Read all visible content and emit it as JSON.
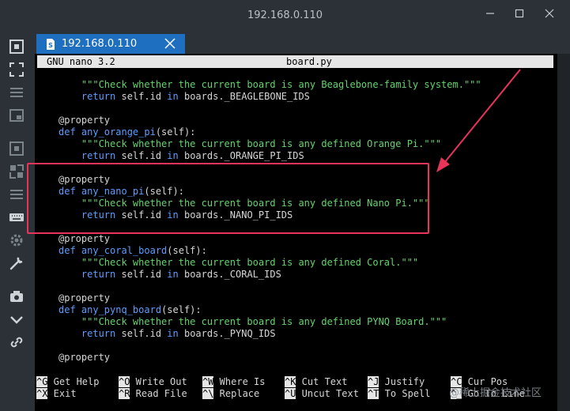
{
  "window": {
    "title": "192.168.0.110"
  },
  "tab": {
    "label": "192.168.0.110"
  },
  "nano": {
    "version": "GNU nano 3.2",
    "filename": "board.py"
  },
  "code_lines": [
    [
      [
        "    ",
        "w"
      ],
      [
        "\"\"\"Check whether the current board is any Beaglebone-family system.\"\"\"",
        "g"
      ]
    ],
    [
      [
        "    return ",
        "k"
      ],
      [
        "self.id ",
        "w"
      ],
      [
        "in ",
        "k"
      ],
      [
        "boards._BEAGLEBONE_IDS",
        "w"
      ]
    ],
    [],
    [
      [
        "@property",
        "w"
      ]
    ],
    [
      [
        "def ",
        "k"
      ],
      [
        "any_orange_pi",
        "k"
      ],
      [
        "(self):",
        "w"
      ]
    ],
    [
      [
        "    ",
        "w"
      ],
      [
        "\"\"\"Check whether the current board is any defined Orange Pi.\"\"\"",
        "g"
      ]
    ],
    [
      [
        "    return ",
        "k"
      ],
      [
        "self.id ",
        "w"
      ],
      [
        "in ",
        "k"
      ],
      [
        "boards._ORANGE_PI_IDS",
        "w"
      ]
    ],
    [],
    [
      [
        "@property",
        "w"
      ]
    ],
    [
      [
        "def ",
        "k"
      ],
      [
        "any_nano_pi",
        "k"
      ],
      [
        "(self):",
        "w"
      ]
    ],
    [
      [
        "    ",
        "w"
      ],
      [
        "\"\"\"Check whether the current board is any defined Nano Pi.\"\"\"",
        "g"
      ]
    ],
    [
      [
        "    return ",
        "k"
      ],
      [
        "self.id ",
        "w"
      ],
      [
        "in ",
        "k"
      ],
      [
        "boards._NANO_PI_IDS",
        "w"
      ]
    ],
    [],
    [
      [
        "@property",
        "w"
      ]
    ],
    [
      [
        "def ",
        "k"
      ],
      [
        "any_coral_board",
        "k"
      ],
      [
        "(self):",
        "w"
      ]
    ],
    [
      [
        "    ",
        "w"
      ],
      [
        "\"\"\"Check whether the current board is any defined Coral.\"\"\"",
        "g"
      ]
    ],
    [
      [
        "    return ",
        "k"
      ],
      [
        "self.id ",
        "w"
      ],
      [
        "in ",
        "k"
      ],
      [
        "boards._CORAL_IDS",
        "w"
      ]
    ],
    [],
    [
      [
        "@property",
        "w"
      ]
    ],
    [
      [
        "def ",
        "k"
      ],
      [
        "any_pynq_board",
        "k"
      ],
      [
        "(self):",
        "w"
      ]
    ],
    [
      [
        "    ",
        "w"
      ],
      [
        "\"\"\"Check whether the current board is any defined PYNQ Board.\"\"\"",
        "g"
      ]
    ],
    [
      [
        "    return ",
        "k"
      ],
      [
        "self.id ",
        "w"
      ],
      [
        "in ",
        "k"
      ],
      [
        "boards._PYNQ_IDS",
        "w"
      ]
    ],
    [],
    [
      [
        "@property",
        "w"
      ]
    ]
  ],
  "shortcuts": [
    {
      "key": "^G",
      "label": "Get Help"
    },
    {
      "key": "^O",
      "label": "Write Out"
    },
    {
      "key": "^W",
      "label": "Where Is"
    },
    {
      "key": "^K",
      "label": "Cut Text"
    },
    {
      "key": "^J",
      "label": "Justify"
    },
    {
      "key": "^C",
      "label": "Cur Pos"
    },
    {
      "key": "^X",
      "label": "Exit"
    },
    {
      "key": "^R",
      "label": "Read File"
    },
    {
      "key": "^\\",
      "label": "Replace"
    },
    {
      "key": "^U",
      "label": "Uncut Text"
    },
    {
      "key": "^T",
      "label": "To Spell"
    },
    {
      "key": "^_",
      "label": "Go To Line"
    }
  ],
  "watermark": "@稀土掘金技术社区",
  "colors": {
    "accent_tab": "#1e6fbf",
    "highlight": "#e8335b",
    "string": "#66d36e",
    "keyword": "#5c9dff"
  },
  "icons": {
    "window": [
      "minimize-icon",
      "maximize-icon",
      "close-icon"
    ],
    "sidebar": [
      "session-icon",
      "expand-icon",
      "menu-icon",
      "layout-icon",
      "fullscreen-icon",
      "split-icon",
      "list-icon",
      "keyboard-icon",
      "settings-icon",
      "tools-icon",
      "camera-icon",
      "chevron-down-icon",
      "link-icon"
    ]
  }
}
